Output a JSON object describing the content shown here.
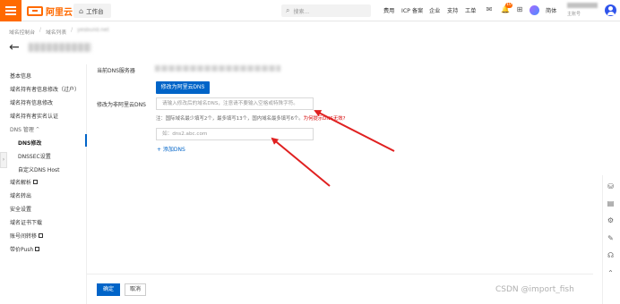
{
  "topbar": {
    "logo_text": "阿里云",
    "workspace": "工作台",
    "search_placeholder": "搜索...",
    "nav": [
      "费用",
      "ICP 备案",
      "企业",
      "支持",
      "工单"
    ],
    "notification_count": "10",
    "language": "简体",
    "account_sub": "主账号"
  },
  "breadcrumb": {
    "items": [
      "域名控制台",
      "域名列表"
    ],
    "current_blurred": "yesbuild.net"
  },
  "sidebar": {
    "items": [
      {
        "label": "基本信息"
      },
      {
        "label": "域名持有者信息修改（过户）"
      },
      {
        "label": "域名持有信息修改"
      },
      {
        "label": "域名持有者实名认证"
      },
      {
        "label": "DNS 管理"
      },
      {
        "label": "DNS修改"
      },
      {
        "label": "DNSSEC设置"
      },
      {
        "label": "自定义DNS Host"
      },
      {
        "label": "域名解析"
      },
      {
        "label": "域名转出"
      },
      {
        "label": "安全设置"
      },
      {
        "label": "域名证书下载"
      },
      {
        "label": "账号间转移"
      },
      {
        "label": "带价Push"
      }
    ]
  },
  "form": {
    "current_dns_label": "当前DNS服务器",
    "switch_button": "修改为阿里云DNS",
    "custom_dns_label": "修改为非阿里云DNS",
    "input1_placeholder": "请输入修改后的域名DNS，注意请不要输入空格或特殊字符。",
    "note_text": "注：国际域名最少填写2个，最多填写13个，国内域名最多填写6个。",
    "note_link": "为何提示DNS无效?",
    "input2_placeholder": "如：dns2.abc.com",
    "add_link": "+ 添加DNS"
  },
  "footer": {
    "confirm": "确定",
    "cancel": "取消"
  },
  "watermark": "CSDN @import_fish",
  "colors": {
    "brand": "#ff6a00",
    "primary": "#0064c8",
    "annotation": "#e02020"
  }
}
